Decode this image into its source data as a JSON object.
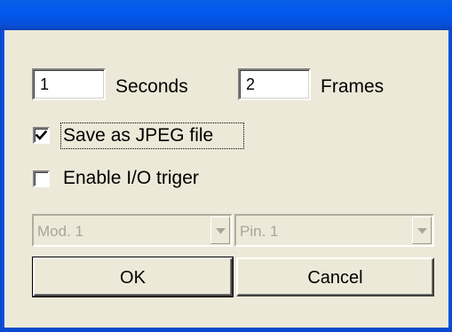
{
  "fields": {
    "seconds_value": "1",
    "seconds_label": "Seconds",
    "frames_value": "2",
    "frames_label": "Frames"
  },
  "options": {
    "save_jpeg_label": "Save as JPEG file",
    "save_jpeg_checked": true,
    "enable_io_label": "Enable I/O triger",
    "enable_io_checked": false
  },
  "selectors": {
    "module_value": "Mod. 1",
    "pin_value": "Pin. 1"
  },
  "buttons": {
    "ok_label": "OK",
    "cancel_label": "Cancel"
  },
  "colors": {
    "titlebar": "#0058ee",
    "dialog_face": "#ece9d8",
    "disabled_text": "#a7a698"
  }
}
